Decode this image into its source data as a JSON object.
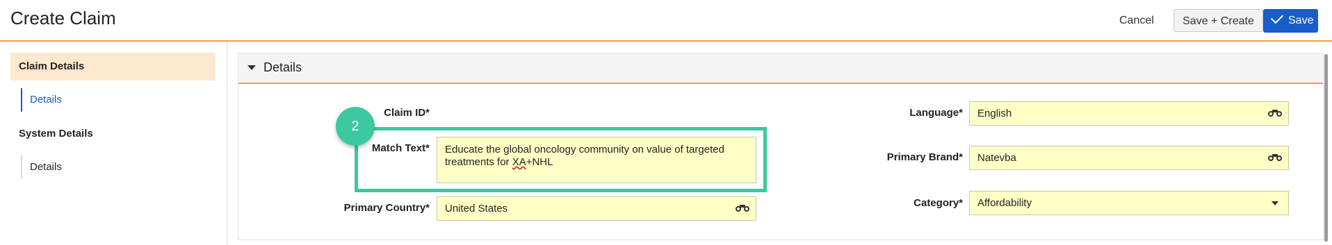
{
  "header": {
    "title": "Create Claim",
    "cancel_label": "Cancel",
    "save_create_label": "Save + Create",
    "save_label": "Save"
  },
  "sidebar": {
    "groups": [
      {
        "label": "Claim Details",
        "items": [
          {
            "label": "Details"
          }
        ]
      },
      {
        "label": "System Details",
        "items": [
          {
            "label": "Details"
          }
        ]
      }
    ]
  },
  "section": {
    "title": "Details"
  },
  "form": {
    "claim_id": {
      "label": "Claim ID*",
      "value": ""
    },
    "match_text": {
      "label": "Match Text*",
      "value_pre": "Educate the global oncology community on value of targeted treatments for ",
      "value_misspelled": "XA",
      "value_post": "+NHL"
    },
    "primary_country": {
      "label": "Primary Country*",
      "value": "United States"
    },
    "language": {
      "label": "Language*",
      "value": "English"
    },
    "primary_brand": {
      "label": "Primary Brand*",
      "value": "Natevba"
    },
    "category": {
      "label": "Category*",
      "value": "Affordability"
    }
  },
  "annotation": {
    "step_number": "2",
    "color": "#3cc9a0"
  },
  "colors": {
    "accent": "#f0a040",
    "primary": "#1a5cc8",
    "field_bg": "#ffffc6"
  },
  "icons": {
    "lookup": "binoculars-icon",
    "dropdown": "chevron-down-icon",
    "section_toggle": "caret-down-icon",
    "save": "check-icon"
  }
}
